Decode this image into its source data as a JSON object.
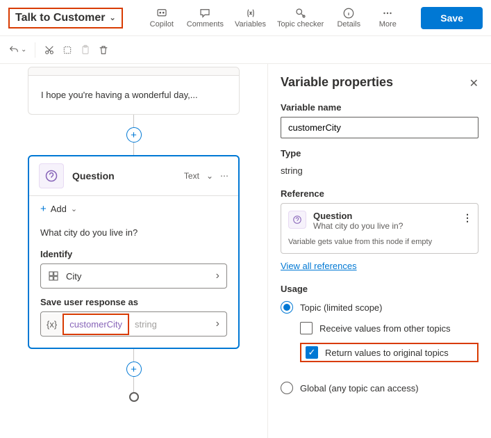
{
  "toolbar": {
    "topic_name": "Talk to Customer",
    "copilot": "Copilot",
    "comments": "Comments",
    "variables": "Variables",
    "topic_checker": "Topic checker",
    "details": "Details",
    "more": "More",
    "save": "Save"
  },
  "canvas": {
    "message_node": {
      "body": "I hope you're having a wonderful day,..."
    },
    "question_node": {
      "title": "Question",
      "type_badge": "Text",
      "add_label": "Add",
      "prompt": "What city do you live in?",
      "identify_label": "Identify",
      "identify_value": "City",
      "save_label": "Save user response as",
      "var_prefix": "{x}",
      "var_name": "customerCity",
      "var_type": "string"
    }
  },
  "panel": {
    "title": "Variable properties",
    "var_name_label": "Variable name",
    "var_name_value": "customerCity",
    "type_label": "Type",
    "type_value": "string",
    "reference_label": "Reference",
    "ref_title": "Question",
    "ref_sub": "What city do you live in?",
    "ref_note": "Variable gets value from this node if empty",
    "view_all": "View all references",
    "usage_label": "Usage",
    "usage_topic": "Topic (limited scope)",
    "usage_receive": "Receive values from other topics",
    "usage_return": "Return values to original topics",
    "usage_global": "Global (any topic can access)"
  }
}
